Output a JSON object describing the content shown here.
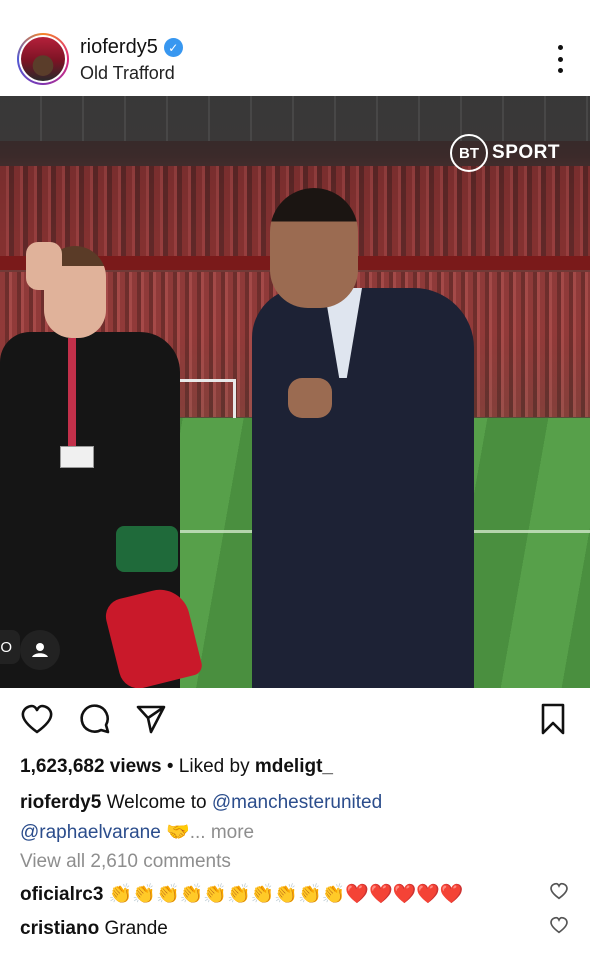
{
  "header": {
    "username": "rioferdy5",
    "verified": true,
    "location": "Old Trafford"
  },
  "media": {
    "watermark_logo": "BT",
    "watermark_text": "SPORT",
    "tag_left_glyph": "O"
  },
  "actions": {
    "like_icon": "heart-icon",
    "comment_icon": "comment-icon",
    "share_icon": "paper-plane-icon",
    "save_icon": "bookmark-icon"
  },
  "stats": {
    "views": "1,623,682 views",
    "separator": "•",
    "liked_by_prefix": "Liked by",
    "liked_by_user": "mdeligt_"
  },
  "caption": {
    "username": "rioferdy5",
    "text": "Welcome to",
    "mention1": "@manchesterunited",
    "mention2": "@raphaelvarane",
    "emoji": "🤝",
    "more": "... more"
  },
  "comments_link": "View all 2,610 comments",
  "comments": [
    {
      "username": "oficialrc3",
      "text": "👏👏👏👏👏👏👏👏👏👏❤️❤️❤️❤️❤️"
    },
    {
      "username": "cristiano",
      "text": "Grande"
    }
  ]
}
